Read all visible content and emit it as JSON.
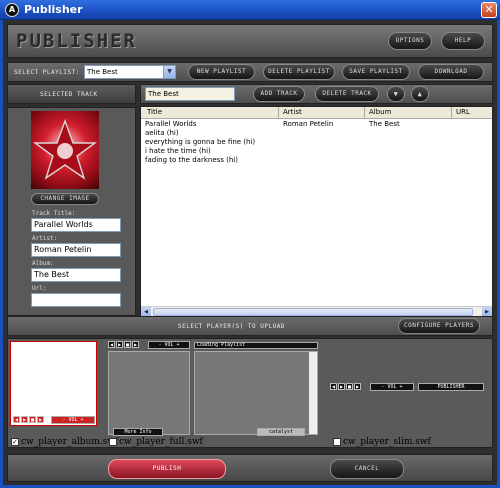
{
  "window": {
    "title": "Publisher",
    "app_icon": "A"
  },
  "header": {
    "logo": "PUBLISHER",
    "options_label": "OPTIONS",
    "help_label": "HELP"
  },
  "playlist_bar": {
    "label": "SELECT PLAYLIST:",
    "selected": "The Best",
    "new_label": "NEW PLAYLIST",
    "delete_label": "DELETE PLAYLIST",
    "save_label": "SAVE PLAYLIST",
    "download_label": "DOWNLOAD"
  },
  "track_bar": {
    "selected_track_label": "SELECTED TRACK",
    "name_value": "The Best",
    "add_label": "ADD TRACK",
    "delete_label": "DELETE TRACK"
  },
  "track_details": {
    "change_image_label": "CHANGE IMAGE",
    "title_label": "Track Title:",
    "title_value": "Parallel Worlds",
    "artist_label": "Artist:",
    "artist_value": "Roman Petelin",
    "album_label": "Album:",
    "album_value": "The Best",
    "url_label": "Url:",
    "url_value": ""
  },
  "track_table": {
    "columns": [
      "Title",
      "Artist",
      "Album",
      "URL"
    ],
    "rows": [
      [
        "Parallel Worlds",
        "Roman Petelin",
        "The Best",
        ""
      ],
      [
        "aelita (hi)",
        "",
        "",
        ""
      ],
      [
        "everything is gonna be fine (hi)",
        "",
        "",
        ""
      ],
      [
        "i hate the time (hi)",
        "",
        "",
        ""
      ],
      [
        "fading to the darkness (hi)",
        "",
        "",
        ""
      ]
    ]
  },
  "players_bar": {
    "label": "SELECT PLAYER(S) TO UPLOAD",
    "configure_label": "CONFIGURE PLAYERS"
  },
  "players": {
    "vol_label": "- VOL +",
    "more_info": "More Info",
    "loading": "Loading Playlist",
    "catalog": "catalyst",
    "publisher_tag": "PUBLISHER",
    "items": [
      {
        "name": "cw_player_album.swf",
        "checked": true
      },
      {
        "name": "cw_player_full.swf",
        "checked": false
      },
      {
        "name": "cw_player_slim.swf",
        "checked": false
      }
    ]
  },
  "footer": {
    "publish_label": "PUBLISH",
    "cancel_label": "CANCEL"
  },
  "colors": {
    "publish_red": "#b8283a",
    "title_blue": "#1a4fc0",
    "art_red": "#d31e2e"
  }
}
